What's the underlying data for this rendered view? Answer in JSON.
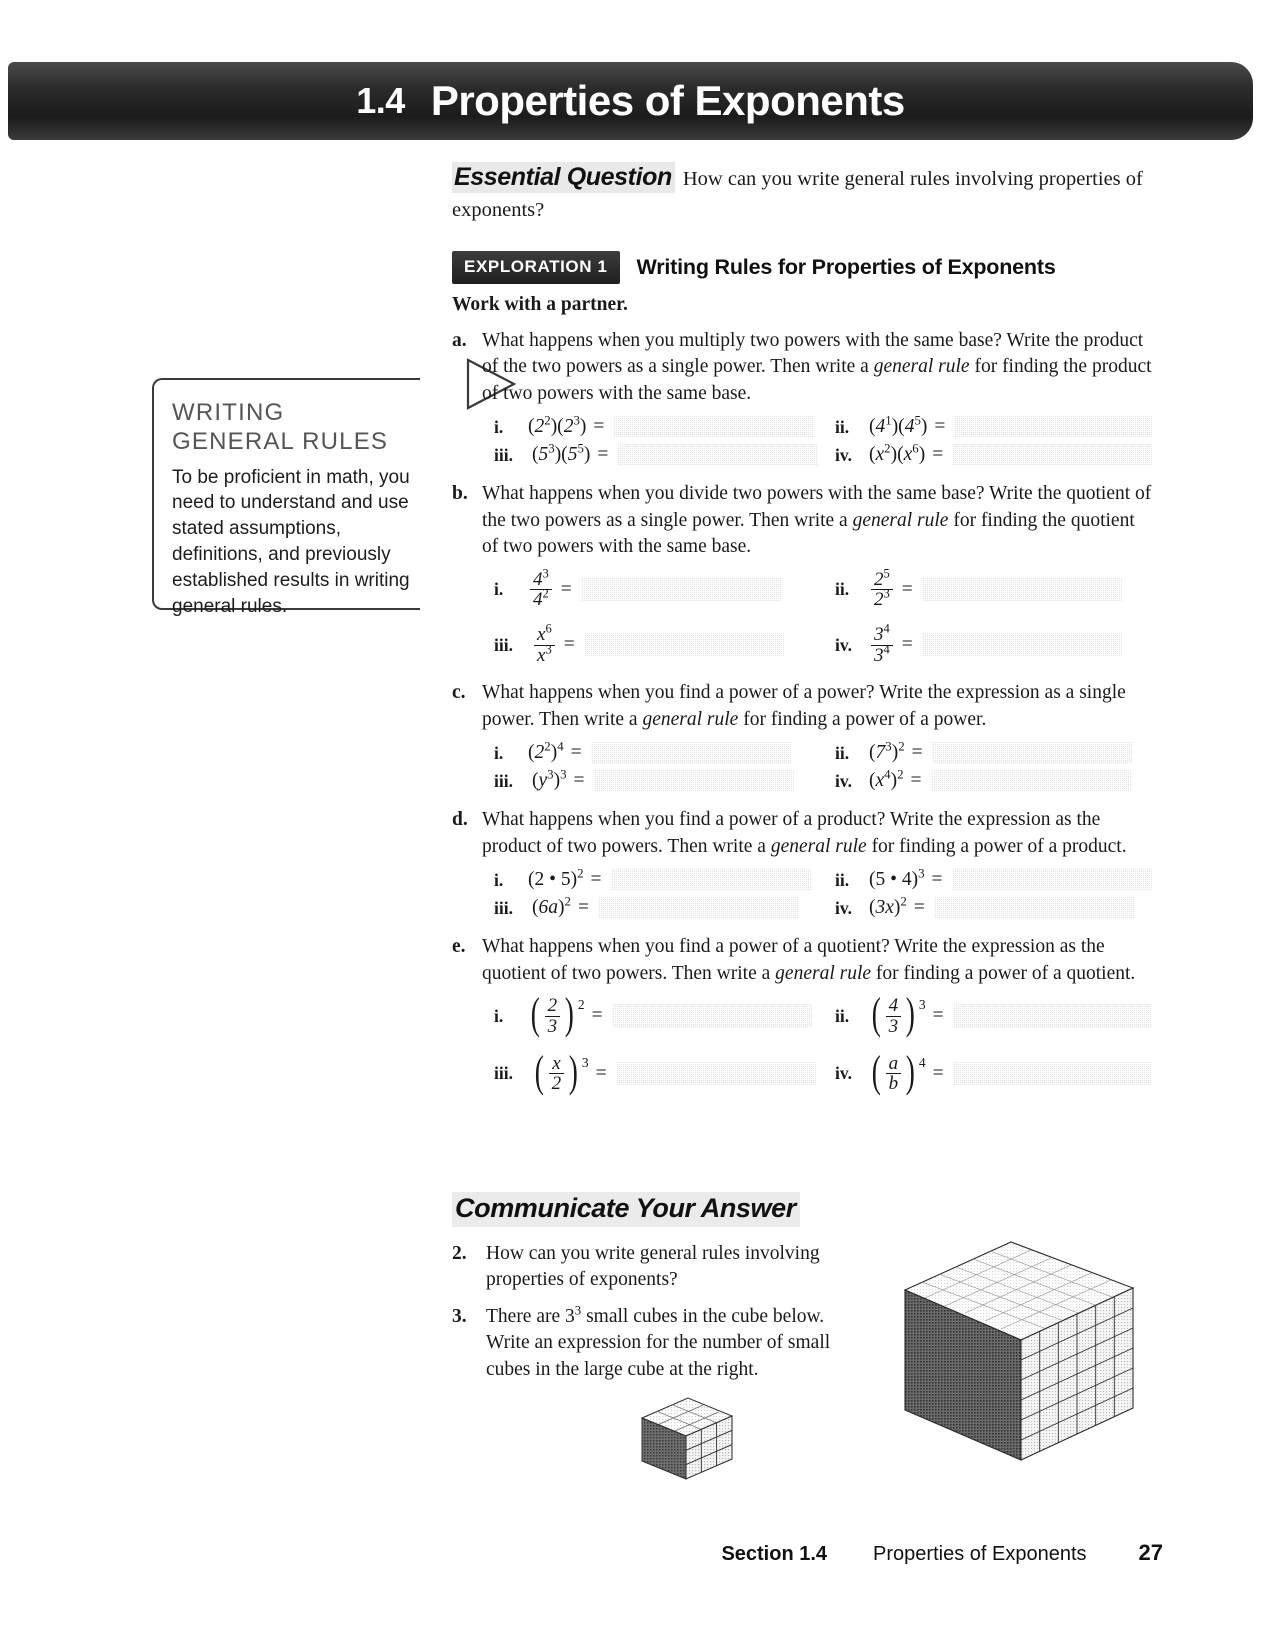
{
  "header": {
    "section_number": "1.4",
    "title": "Properties of Exponents"
  },
  "essential_question": {
    "label": "Essential Question",
    "text": "How can you write general rules involving properties of exponents?"
  },
  "exploration": {
    "badge": "EXPLORATION 1",
    "title": "Writing Rules for Properties of Exponents",
    "directive": "Work with a partner."
  },
  "sidenote": {
    "title_line1": "WRITING",
    "title_line2": "GENERAL RULES",
    "body": "To be proficient in math, you need to understand and use stated assumptions, definitions, and previously established results in writing general rules."
  },
  "parts": [
    {
      "letter": "a.",
      "prompt_1": "What happens when you multiply two powers with the same base? Write the product of the two powers as a single power. Then write a ",
      "prompt_em": "general rule",
      "prompt_2": " for finding the product of two powers with the same base.",
      "items": [
        {
          "rn": "i.",
          "type": "inline",
          "base1": "2",
          "exp1": "2",
          "base2": "2",
          "exp2": "3"
        },
        {
          "rn": "ii.",
          "type": "inline",
          "base1": "4",
          "exp1": "1",
          "base2": "4",
          "exp2": "5"
        },
        {
          "rn": "iii.",
          "type": "inline",
          "base1": "5",
          "exp1": "3",
          "base2": "5",
          "exp2": "5"
        },
        {
          "rn": "iv.",
          "type": "inline",
          "base1": "x",
          "exp1": "2",
          "base2": "x",
          "exp2": "6"
        }
      ]
    },
    {
      "letter": "b.",
      "prompt_1": "What happens when you divide two powers with the same base? Write the quotient of the two powers as a single power. Then write a ",
      "prompt_em": "general rule",
      "prompt_2": " for finding the quotient of two powers with the same base.",
      "items": [
        {
          "rn": "i.",
          "num_base": "4",
          "num_exp": "3",
          "den_base": "4",
          "den_exp": "2"
        },
        {
          "rn": "ii.",
          "num_base": "2",
          "num_exp": "5",
          "den_base": "2",
          "den_exp": "3"
        },
        {
          "rn": "iii.",
          "num_base": "x",
          "num_exp": "6",
          "den_base": "x",
          "den_exp": "3"
        },
        {
          "rn": "iv.",
          "num_base": "3",
          "num_exp": "4",
          "den_base": "3",
          "den_exp": "4"
        }
      ]
    },
    {
      "letter": "c.",
      "prompt_1": "What happens when you find a power of a power? Write the expression as a single power. Then write a ",
      "prompt_em": "general rule",
      "prompt_2": " for finding a power of a power.",
      "items": [
        {
          "rn": "i.",
          "base": "2",
          "inner_exp": "2",
          "outer_exp": "4"
        },
        {
          "rn": "ii.",
          "base": "7",
          "inner_exp": "3",
          "outer_exp": "2"
        },
        {
          "rn": "iii.",
          "base": "y",
          "inner_exp": "3",
          "outer_exp": "3"
        },
        {
          "rn": "iv.",
          "base": "x",
          "inner_exp": "4",
          "outer_exp": "2"
        }
      ]
    },
    {
      "letter": "d.",
      "prompt_1": "What happens when you find a power of a product? Write the expression as the product of two powers. Then write a ",
      "prompt_em": "general rule",
      "prompt_2": " for finding a power of a product.",
      "items": [
        {
          "rn": "i.",
          "inner": "2 • 5",
          "exp": "2"
        },
        {
          "rn": "ii.",
          "inner": "5 • 4",
          "exp": "3"
        },
        {
          "rn": "iii.",
          "inner": "6a",
          "exp": "2",
          "italic_tail": true
        },
        {
          "rn": "iv.",
          "inner": "3x",
          "exp": "2",
          "italic_tail": true
        }
      ]
    },
    {
      "letter": "e.",
      "prompt_1": "What happens when you find a power of a quotient? Write the expression as the quotient of two powers. Then write a ",
      "prompt_em": "general rule",
      "prompt_2": " for finding a power of a quotient.",
      "items": [
        {
          "rn": "i.",
          "num": "2",
          "den": "3",
          "exp": "2"
        },
        {
          "rn": "ii.",
          "num": "4",
          "den": "3",
          "exp": "3"
        },
        {
          "rn": "iii.",
          "num": "x",
          "den": "2",
          "exp": "3"
        },
        {
          "rn": "iv.",
          "num": "a",
          "den": "b",
          "exp": "4"
        }
      ]
    }
  ],
  "communicate": {
    "title": "Communicate Your Answer",
    "items": [
      {
        "num": "2.",
        "text": "How can you write general rules involving properties of exponents?"
      },
      {
        "num": "3.",
        "text_1": "There are 3",
        "sup": "3",
        "text_2": " small cubes in the cube below. Write an expression for the number of small cubes in the large cube at the right."
      }
    ]
  },
  "footer": {
    "section": "Section 1.4",
    "title": "Properties of Exponents",
    "page": "27"
  }
}
